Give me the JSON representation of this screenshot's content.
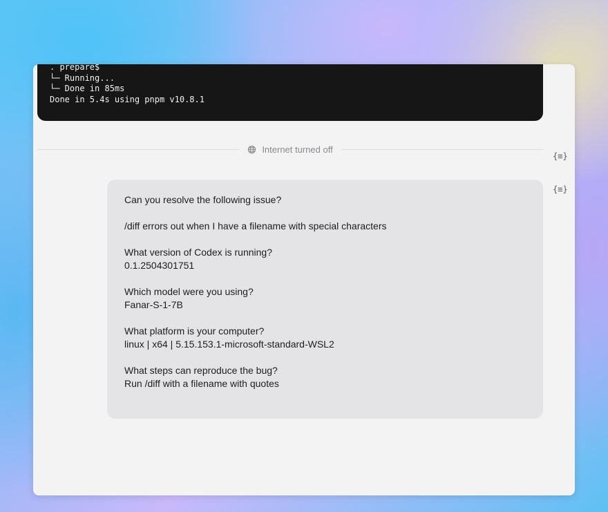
{
  "terminal": {
    "lines": [
      ". prepare$",
      "└─ Running...",
      "└─ Done in 85ms",
      "Done in 5.4s using pnpm v10.8.1"
    ]
  },
  "divider": {
    "icon": "globe-icon",
    "label": "Internet turned off"
  },
  "side_icons": {
    "glyph": "{≡}",
    "icon": "json-braces-icon"
  },
  "message": {
    "paragraphs": [
      [
        "Can you resolve the following issue?"
      ],
      [
        "/diff errors out when I have a filename with special characters"
      ],
      [
        "What version of Codex is running?",
        "0.1.2504301751"
      ],
      [
        "Which model were you using?",
        "Fanar-S-1-7B"
      ],
      [
        "What platform is your computer?",
        "linux | x64 | 5.15.153.1-microsoft-standard-WSL2"
      ],
      [
        "What steps can reproduce the bug?",
        "Run /diff with a filename with quotes"
      ]
    ]
  }
}
